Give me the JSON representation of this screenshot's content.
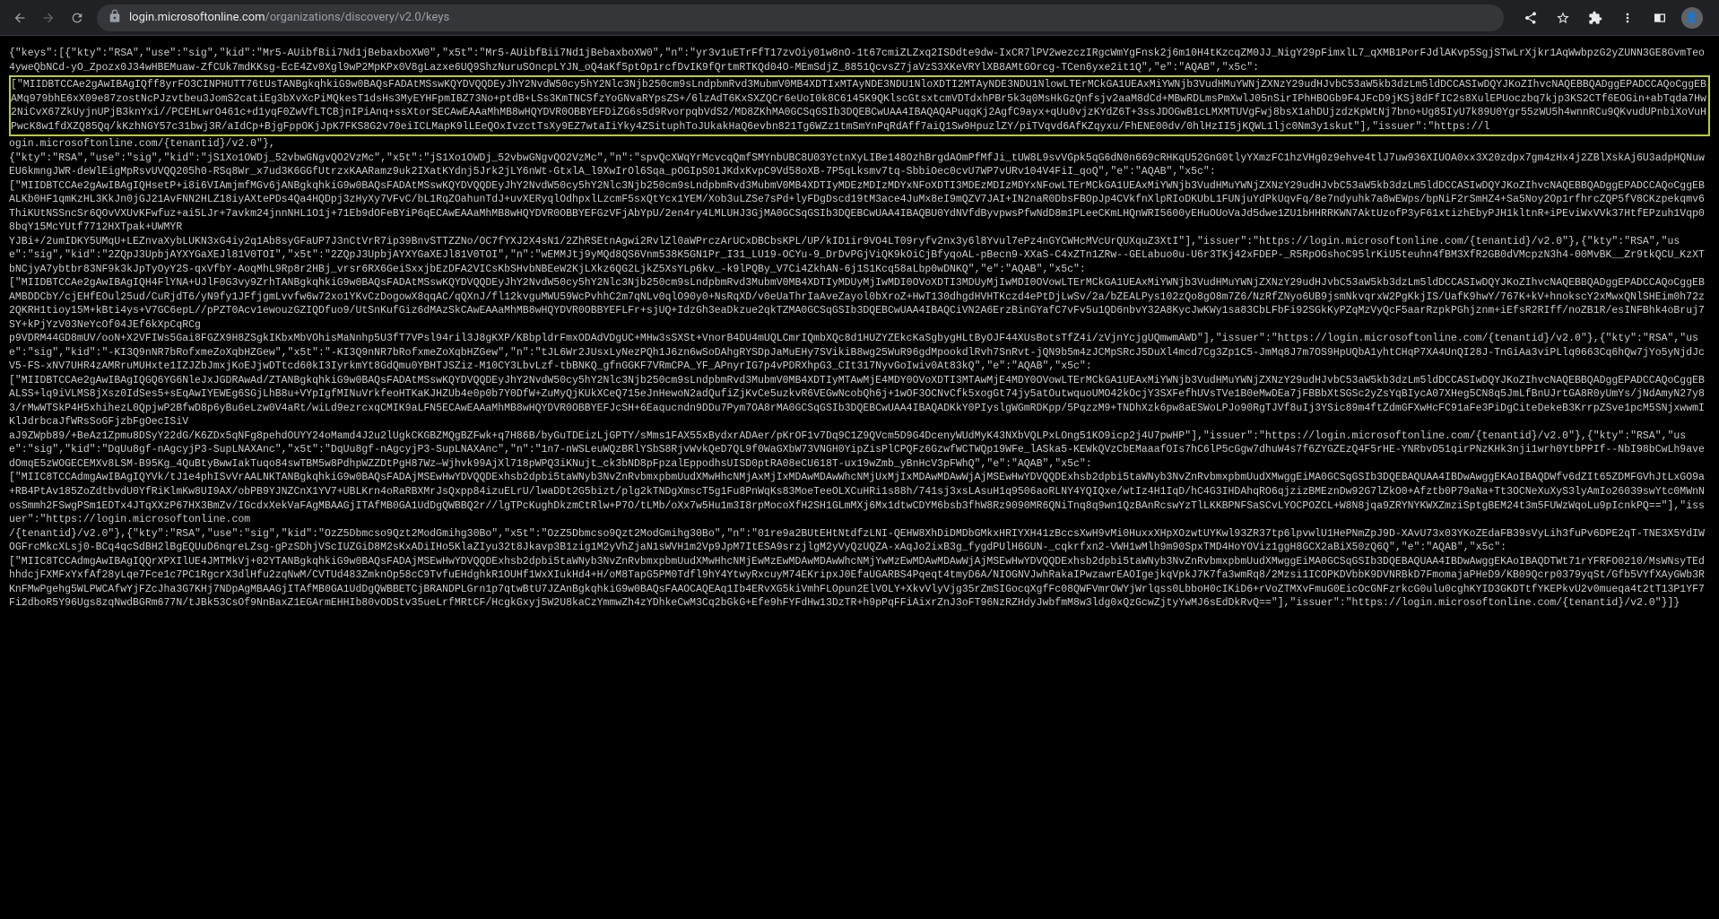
{
  "browser": {
    "url_host": "login.microsoftonline.com",
    "url_path": "/organizations/discovery/v2.0/keys"
  },
  "json_content": {
    "prefix": "{\"keys\":[{\"kty\":\"RSA\",\"use\":\"sig\",\"kid\":\"Mr5-AUibfBii7Nd1jBebaxboXW0\",\"x5t\":\"Mr5-AUibfBii7Nd1jBebaxboXW0\",\"n\":\"yr3v1uETrFfT17zvOiy01w8nO-1t67cmiZLZxq2ISDdte9dw-IxCR7lPV2wezczIRgcWmYgFnsk2j6m10H4tKzcqZM0JJ_NigY29pFimxlL7_qXMB1PorFJdlAKvp5SgjSTwLrXjkr1AqWwbpzG2yZUNN3GE8GvmTeo4yweQbNCd-yO_Zpozx0J34wHBEMuaw-ZfCUk7mdKKsg-EcE4Zv0Xgl9wP2MpKPx0V8gLazxe6UQ9ShzNuruSOncpLYJN_oQ4aKf5ptOp1rcfDvIK9fQrtmRTKQd04O-MEmSdjZ_8851QcvsZ7jaVzS3XKeVRYlXB8AMtGOrcg-TCen6yxe2it1Q\",\"e\":\"AQAB\",\"x5c\":",
    "highlighted": "[\"MIIDBTCCAe2gAwIBAgIQff8yrFO3CINPHUTT76tUsTANBgkqhkiG9w0BAQsFADAtMSswKQYDVQQDEyJhY2NvdW50cy5hY2Nlc3Njb250cm9sLndpbmRvd3MubmV0MB4XDTIxMTAyNDE3NDU1NloXDTI2MTAyNDE3NDU1NlowLTErMCkGA1UEAxMiYWNjb3VudHMuYWNjZXNzY29udHJvbC53aW5kb3dzLm5ldDCCASIwDQYJKoZIhvcNAQEBBQADggEPADCCAQoCggEBAMq979bhE6xX09e87zostNcPJzvtbeu3JomS2catiEg3bXvXcPiMQkesT1dsHs3MyEYHFpmIBZ73No+ptdB+LSs3KmTNCSfzYoGNvaRYpsZS+/6lzAdT6KxSXZQCr6eUoI0k8C6145K9QKlscGtsxtcmVDTdxhPBr5k3q0MsHkGzQnfsjv2aaM8dCd+MBwRDLmsPmXwlJ05nSirIPhHBOGb9F4JFcD9jKSj8dFfIC2s8XulEPUoczbq7kjp3KS2CTf6EOGin+abTqda7Hw2NiCvX67ZkUyjnUPjB3knYxi//PCEHLwrO461c+d1yqF0ZwVfLTCBjnIPiAnq+ssXtorSECAwEAAaMhMB8wHQYDVR0OBBYEFDiZG6s5d9RvorpqbVdS2/MD8ZKhMA0GCSqGSIb3DQEBCwUAA4IBAQAQAPuqqKj2AgfC9ayx+qUu0vjzKYdZ6T+3ssJDOGwB1cLMXMTUVgFwj8bsX1ahDUjzdzKpWtNj7bno+Ug85IyU7k89U0Ygr55zWU5h4wnnRCu9QKvudUPnbiXoVuHPwcK8w1fdXZQ85Qq/kKzhNGY57c31bwj3R/aIdCp+BjgFppOKjJpK7FKS8G2v70eiICLMapK9lLEeQOxIvzctTsXy9EZ7wtaIiYky4ZSituphToJUkakHaQ6evbn821Tg6WZz1tmSmYnPqRdAff7aiQ1Sw9HpuzlZY/piTVqvd6AfKZqyxu/FhENE00dv/0hlHzII5jKQWL1ljc0Nm3y1skut\"],\"issuer\":\"https://l",
    "suffix_part1": "ogin.microsoftonline.com/{tenantid}/v2.0\"},\n{\"kty\":\"RSA\",\"use\":\"sig\",\"kid\":\"jS1Xo1OWDj_52vbwGNgvQO2VzMc\",\"x5t\":\"jS1Xo1OWDj_52vbwGNgvQO2VzMc\",\"n\":\"spvQcXWqYrMcvcqQmfSMYnbUBC8U03YctnXyLIBe148OzhBrgdAOmPfMfJi_tUW8L9svVGpk5qG6dN0n669cRHKqU52GnG0tlyYXmzFC1hzVHg0z9ehve4tlJ7uw936XIUOA0xx3X20zdpx7gm4zHx4j2ZBlXskAj6U3adpHQNuwEU6kmngJWR-deWlEigMpRsvUVQQ205h0-RSq8Wr_x7ud3K6GGfUtrzxKAARamz9uk2IXatKYdnj5Jrk2jLY6nWt-GtxlA_l9XwIrOl6Sqa_pOGIpS01JKdxKvpC9Vd58oXB-7P5qLksmv7tq-SbbiOec0cvU7WP7vURv104V4FiI_qoQ\",\"e\":\"AQAB\",\"x5c\":\n[\"MIIDBTCCAe2gAwIBAgIQHsetP+i8i6VIAmjmfMGv6jANBgkqhkiG9w0BAQsFADAtMSswKQYDVQQDEyJhY2NvdW50cy5hY2Nlc3Njb250cm9sLndpbmRvd3MubmV0MB4XDTIyMDEzMDIzMDYxNFoXDTI3MDEzMDIzMDYxNFowLTErMCkGA1UEAxMiYWNjb3VudHMuYWNjZXNzY29udHJvbC53aW5kb3dzLm5ldDCCASIwDQYJKoZIhvcNAQEBBQADggEPADCCAQoCggEBALKb0HF1qmKzHL3KkJn0jGJ21AvFNN2HLZ18iyAXtePDs4Qa4HQDpj3zHyXy7VFvC/bL1RqZOahunTdJ+uvXERyqlOdhpxlLzcmF5sxQtYcx1YEM/Xob3uLZSe7sPd+lyFDgDscd19tM3ace4JuMx8eI9mQZV7JAI+IN2naR0DbsFBOpJp4CVkfnXlpRIoDKUbL1FUNjuYdPkUqvFq/8e7ndyuhk7a8wEWps/bpNiF2rSmHZ4+Sa5Noy2Op1rfhrcZQP5fV8CKzpekqmv6ThiKUtNSSncSr6QOvVXUvKFwfuz+ai5LJr+7avkm24jnnNHL1O1j+71Eb9dOFeBYiP6qECAwEAAaMhMB8wHQYDVR0OBBYEFGzVFjAbYpU/2en4ry4LMLUHJ3GjMA0GCSqGSIb3DQEBCwUAA4IBAQBU0YdNVfdByvpwsPfwNdD8m1PLeeCKmLHQnWRI5600yEHuOUoVaJd5dwe1ZU1bHHRRKWN7AktUzofP3yF61xtizhEbyPJH1kltnR+iPEviWxVVk37HtfEPzuh1Vqp08bqY15McYUtf7712HXTpak+UWMYR",
    "suffix_part2": "YJBi+/2umIDKY5UMqU+LEZnvaXybLUKN3xG4iy2q1Ab8syGFaUP7J3nCtVrR7ip39BnvSTTZZNo/OC7fYXJ2X4sN1/2ZhRSEtnAgwi2RvlZl0aWPrczArUCxDBCbsKPL/UP/kID1ir9VO4LT09ryfv2nx3y6l8Yvul7ePz4nGYCWHcMVcUrQUXquZ3XtI\"],\"issuer\":\"https://login.microsoftonline.com/{tenantid}/v2.0\"},{\"kty\":\"RSA\",\"use\":\"sig\",\"kid\":\"2ZQpJ3UpbjAYXYGaXEJl81V0TOI\",\"x5t\":\"2ZQpJ3UpbjAYXYGaXEJl81V0TOI\",\"n\":\"wEMMJtj9yMQd8QS6Vnm538K5GN1Pr_I31_LU19-OCYu-9_DrDvPGjViQK9kOiCjBfyqoAL-pBecn9-XXaS-C4xZTn1ZRw--GELabuo0u-U6r3TKj42xFDEP-_R5RpOGshoC95lrKiU5teuhn4fBM3XfR2GB0dVMcpzN3h4-00MvBK__Zr9tkQCU_KzXTbNCjyA7ybtbr83NF9k3kJpTyOyY2S-qxVfbY-AoqMhL9Rp8r2HBj_vrsr6RX6GeiSxxjbEzDFA2VICsKbSHvbNBEeW2KjLXkz6QG2LjkZ5XsYLp6kv_-k9lPQBy_V7Ci4ZkhAN-6j1S1Kcq58aLbp0wDNKQ\",\"e\":\"AQAB\",\"x5c\":\n[\"MIIDBTCCAe2gAwIBAgIQH4FlYNA+UJlF0G3vy9ZrhTANBgkqhkiG9w0BAQsFADAtMSswKQYDVQQDEyJhY2NvdW50cy5hY2Nlc3Njb250cm9sLndpbmRvd3MubmV0MB4XDTIyMDUyMjIwMDI0OVoXDTI3MDUyMjIwMDI0OVowLTErMCkGA1UEAxMiYWNjb3VudHMuYWNjZXNzY29udHJvbC53aW5kb3dzLm5ldDCCASIwDQYJKoZIhvcNAQEBBQADggEPADCCAQoCggEBAMBDDCbY/cjEHfEOul25ud/CuRjdT6/yN9fy1JFfjgmLvvfw6w72xo1YKvCzDogowX8qqAC/qQXnJ/fl12kvguMWU59WcPvhhC2m7qNLv0qlO90y0+NsRqXD/v0eUaThrIaAveZayol0bXroZ+HwT130dhgdHVHTKczd4ePtDjLwSv/2a/bZEALPys102zQo8gO8m7Z6/NzRfZNyo6UB9jsmNkvqrxW2PgKkjIS/UafK9hwY/767K+kV+hnokscY2xMwxQNlSHEim0h72z2QKRH1tioy15M+kBti4ys+V7GC6epL//pPZT0Acv1ewouzGZIQDfuo9/UtSnKufGiz6dMAzSkCAwEAAaMhMB8wHQYDVR0OBBYEFLFr+sjUQ+IdzGh3eaDkzue2qkTZMA0GCSqGSIb3DQEBCwUAA4IBAQCiVN2A6ErzBinGYafC7vFv5u1QD6nbvY32A8KycJwKWy1sa83CbLFbFi92SGkKyPZqMzVyQcF5aarRzpkPGhjznm+iEfsR2RIff/noZB1R/esINFBhk4oBruj7SY+kPjYzV03NeYcOf04JEf6kXpCqRCg",
    "suffix_part3": "p9VDRM44GD8mUV/ooN+X2VFIWs5Gai8FGZX9H8ZSgkIKbxMbVOhisMaNnhp5U3fT7VPsl94ril3J8gKXP/KBbpldrFmxODAdVDgUC+MHw3sSXSt+VnorB4DU4mUQLCmrIQmbXQc8d1HUZYZEkcKaSgbygHLtByOJF44XUsBotsTfZ4i/zVjnYcjgUQmwmAWD\"],\"issuer\":\"https://login.microsoftonline.com/{tenantid}/v2.0\"},{\"kty\":\"RSA\",\"use\":\"sig\",\"kid\":\"-KI3Q9nNR7bRofxmeZoXqbHZGew\",\"x5t\":\"-KI3Q9nNR7bRofxmeZoXqbHZGew\",\"n\":\"tJL6Wr2JUsxLyNezPQh1J6zn6wSoDAhgRYSDpJaMuEHy7SVikiB8wg25WuR96gdMpookdlRvh7SnRvt-jQN9b5m4zJCMpSRcJ5DuXl4mcd7Cg3Zp1C5-JmMq8J7m7OS9HpUQbA1yhtCHqP7XA4UnQI28J-TnGiAa3viPLlq0663Cq6hQw7jYo5yNjdJcV5-FS-xNV7UHR4zAMRruMUHxte1IZJZbJmxjKoEJjwDTtcd60kI3IyrkmYt8GdQmu0YBHTJSZiz-M10CY3LbvLzf-tbBNKQ_gfnGGKF7VRmCPA_YF_APnyrIG7p4vPDRXhpG3_CIt317NyvGoIwiv0At83kQ\",\"e\":\"AQAB\",\"x5c\":\n[\"MIIDBTCCAe2gAwIBAgIQGQ6YG6NleJxJGDRAwAd/ZTANBgkqhkiG9w0BAQsFADAtMSswKQYDVQQDEyJhY2NvdW50cy5hY2Nlc3Njb250cm9sLndpbmRvd3MubmV0MB4XDTIyMTAwMjE4MDY0OVoXDTI3MTAwMjE4MDY0OVowLTErMCkGA1UEAxMiYWNjb3VudHMuYWNjZXNzY29udHJvbC53aW5kb3dzLm5ldDCCASIwDQYJKoZIhvcNAQEBBQADggEPADCCAQoCggEBALSS+lq9iVLMS8jXsz0IdSes5+sEqAwIYEWEg6SGjLhB8u+VYpIgfMINuVrkfeoHTKaKJHZUb4e0p0b7Y0DfW+ZuMyQjKUkXCeQ715eJnHewoN2adQufiZjKvCe5uzkvR6VEGwNcobQh6j+1wOF3OCNvCfk5xogGt74jy5atOutwquoUMO42kOcjY3SXFefhUVsTVe1B0eMwDEa7jFBBbXtSGSc2yZsYqBIycA07XHeg5CN8q5JmLfBnUJrtGA8R0yUmYs/jNdAmyN27y83/rMwWTSkP4H5xhihezL0QpjwP2BfwD8p6yBu6eLzw0V4aRt/wiLd9ezrcxqCMIK9aLFN5ECAwEAAaMhMB8wHQYDVR0OBBYEFJcSH+6Eaqucndn9DDu7Pym7OA8rMA0GCSqGSIb3DQEBCwUAA4IBAQADKkY0PIyslgWGmRDKpp/5PqzzM9+TNDhXzk6pw8aESWoLPJo90RgTJVf8uIj3YSic89m4ftZdmGFXwHcFC91aFe3PiDgCiteDekeB3KrrpZSve1pcM5SNjxwwmIKlJdrbcaJfWRsSoGFjzbFgOecISiV",
    "suffix_part4": "aJ9ZWpb89/+BeAz1Zpmu8DSyY22dG/K6ZDx5qNFg8pehdOUYY24oMamd4J2u2lUgkCKGBZMQgBZFwk+q7H86B/byGuTDEizLjGPTY/sMms1FAX55xBydxrADAer/pKrOF1v7Dq9C1Z9QVcm5D9G4DcenyWUdMyK43NXbVQLPxLOng51KO9icp2j4U7pwHP\"],\"issuer\":\"https://login.microsoftonline.com/{tenantid}/v2.0\"},{\"kty\":\"RSA\",\"use\":\"sig\",\"kid\":\"DqUu8gf-nAgcyjP3-SupLNAXAnc\",\"x5t\":\"DqUu8gf-nAgcyjP3-SupLNAXAnc\",\"n\":\"1n7-nWSLeuWQzBRlYSbS8RjvWvkQeD7QL9f0WaGXbW73VNGH0YipZisPlCPQFz6GzwfWCTWQp19WFe_lASka5-KEWkQVzCbEMaaafOIs7hC6lP5cGgw7dhuW4s7f6ZYGZEzQ4F5rHE-YNRbvD51qirPNzKHk3nji1wrh0YtbPPIf--NbI98bCwLh9avedOmqE5zWOGECEMXv8LSM-B95Kg_4QuBtyBwwIakTuqo84swTBM5w8PdhpWZZDtPgH87Wz—Wjhvk99AjXl718pWPQ3iKNujt_ck3bND8pFpzalEppodhsUISD0ptRA08eCU618T-ux19wZmb_yBnHcV3pFWhQ\",\"e\":\"AQAB\",\"x5c\":\n[\"MIIC8TCCAdmgAwIBAgIQYVk/tJ1e4phISvVrAALNKTANBgkqhkiG9w0BAQsFADAjMSEwHwYDVQQDExhsb2dpbi5taWNyb3NvZnRvbmxpbmUudXMwHhcNMjAxMjIxMDAwMDAwWhcNMjUxMjIxMDAwMDAwWjAjMSEwHwYDVQQDExhsb2dpbi5taWNyb3NvZnRvbmxpbmUudXMwggEiMA0GCSqGSIb3DQEBAQUAA4IBDwAwggEKAoIBAQDWfv6dZIt65ZDMFGVhJtLxGO9a+RB4PtAv185ZoZdtbvdU0YfRiKlmKw8UI9AX/obPB9YJNZCnX1YV7+UBLKrn4oRaRBXMrJsQxpp84izuELrU/lwaDDt2G5bizt/plg2kTNDgXmscT5g1Fu8PnWqKs83MoeTeeOLXCuHRi1s88h/741sj3xsLAsuH1q9506aoRLNY4YQIQxe/wtIz4H1IqD/hC4G3IHDAhqRO6qjzizBMEznDw92G7lZkO0+Afztb0P79aNa+Tt3OCNeXuXyS3lyAmIo26039swYtc0MWnNosSmmh2FSwgPSm1EDTx4JTqXXzP67HX3BmZv/IGcdxXekVaFAgMBAAGjITAfMB0GA1UdDgQWBBQ2r//lgTPcKughDkzmCtRlw+P7O/tLMb/oXx7w5Hu1m3I8rpMocoXfH2SH1GLmMXj6Mx1dtwCDYM6bsb3fhW8Rz9090MR6QNiTnq8q9wn1QzBAnRcswYzTlLKKBPNFSaSCvLYOCPOZCL+W8N8jqa9ZRYNYKWXZmziSptgBEM24t3m5FUWzWqoLu9pIcnkPQ==\"],\"issuer\":\"https://login.microsoftonline.com",
    "suffix_part5": "/{tenantid}/v2.0\"},{\"kty\":\"RSA\",\"use\":\"sig\",\"kid\":\"OzZ5Dbmcso9Qzt2ModGmihg30Bo\",\"x5t\":\"OzZ5Dbmcso9Qzt2ModGmihg30Bo\",\"n\":\"01re9a2BUtEHtNtdfzLNI-QEHW8XhDiDMDbGMkxHRIYXH41zBccsXwH9vMi0HuxxXHpXOzwtUYKwl93ZR37tp6lpvwlU1HePNmZpJ9D-XAvU73x03YKoZEdaFB39sVyLih3fuPv6DPE2qT-TNE3X5YdIWOGFrcMkcXLsj0-BCq4qcSdBH2lBgEQUuD6nqreLZsg-gPzSDhjVScIUZGiD8M2sKxADiIHo5KlaZIyu32t8Jkavp3B1zig1M2yVhZjaN1sWVH1m2Vp9JpM7ItESA9srzjlgM2yVyQzUQZA-xAqJo2ixB3g_fygdPUlH6GUN-_cqkrfxn2-VWH1wMlh9m90SpxTMD4HoYOViz1ggH8GCX2aBiX50zQ6Q\",\"e\":\"AQAB\",\"x5c\":\n[\"MIIC8TCCAdmgAwIBAgIQQrXPXIlUE4JMTMkVj+02YTANBgkqhkiG9w0BAQsFADAjMSEwHwYDVQQDExhsb2dpbi5taWNyb3NvZnRvbmxpbmUudXMwHhcNMjEwMzEwMDAwMDAwWhcNMjYwMzEwMDAwMDAwWjAjMSEwHwYDVQQDExhsb2dpbi5taWNyb3NvZnRvbmxpbmUudXMwggEiMA0GCSqGSIb3DQEBAQUAA4IBDwAwggEKAoIBAQDTWt71rYFRFO0210/MsWNsyTEdhhdcjFXMFxYxfAf28yLqe7Fce1c7PC1RgcrX3dlHfu2zqNwM/CVTUd483ZmknOp58cC9TvfuEHdghkR1OUHf1WxXIukHd4+H/oM8TapG5PM0Tdfl9hY4YtwyRxcuyM74EKripxJ0EfaUGARBS4Pqeqt4tmyD6A/NIOGNVJwhRakaIPwzawrEAOIgejkqVpkJ7K7fa3wmRq8/2Mzsi1ICOPKDVbbK9DVNRBkD7FmomajaPHeD9/KB09Qcrp0379yqSt/Gfb5VYfXAyGWb3RKnFMwPgehg5WLPWCAfwYjFZcJha3G7KHj7NDpAgMBAAGjITAfMB0GA1UdDgQWBBETCjBRANDPLGrn1p7qtwBtU7JZAnBgkqhkiG9w0BAQsFAAOCAQEAq1Ib4ERvXG5kiVmhFLOpun2ElVOLY+XkvVlyVjg35rZmSIGocqXgfFc08QWFVmrOWYjWrlqss0LbboH0cIKiD6+rVoZTMXvFmuG0EicOcGNFzrkcG0ulu0cghKYID3GKDTtfYKEPkvU2v0mueqa4t2tT13P1YF7Fi2dboR5Y96Ugs8zqNwdBGRm677N/tJBk53CsOf9NnBaxZ1EGArmEHHIb80vODStv35ueLrfMRtCF/HcgkGxyj5W2U8kaCzYmmwZh4zYDhkeCwM3Cq2bGkG+Efe9hFYFdHw13DzTR+h9pPqFFiAixrZnJ3oFT96NzRZHdyJwbfmM8w3ldg0xQzGcwZjtyYwMJ6sEdDkRvQ==\"],\"issuer\":\"https://login.microsoftonline.com/{tenantid}/v2.0\"}]}"
  }
}
